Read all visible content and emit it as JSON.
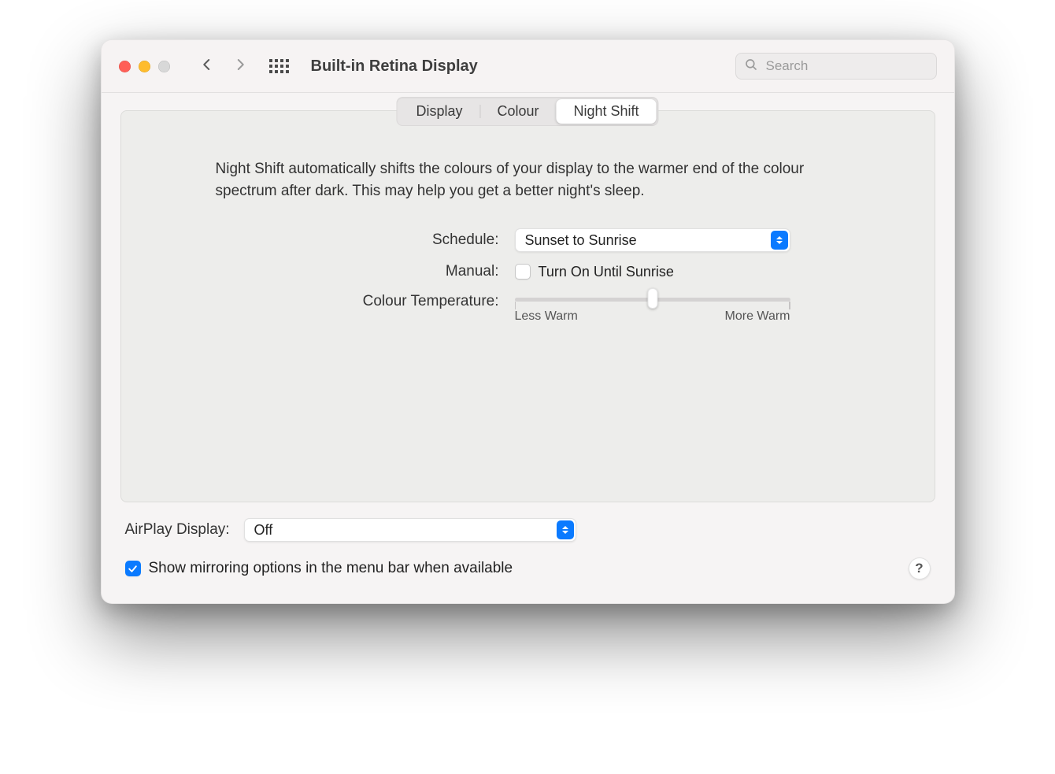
{
  "window": {
    "title": "Built-in Retina Display"
  },
  "search": {
    "placeholder": "Search"
  },
  "tabs": [
    {
      "label": "Display",
      "active": false
    },
    {
      "label": "Colour",
      "active": false
    },
    {
      "label": "Night Shift",
      "active": true
    }
  ],
  "pane": {
    "description": "Night Shift automatically shifts the colours of your display to the warmer end of the colour spectrum after dark. This may help you get a better night's sleep.",
    "schedule_label": "Schedule:",
    "schedule_value": "Sunset to Sunrise",
    "manual_label": "Manual:",
    "manual_checkbox_label": "Turn On Until Sunrise",
    "manual_checked": false,
    "temp_label": "Colour Temperature:",
    "temp_min_label": "Less Warm",
    "temp_max_label": "More Warm",
    "temp_value_percent": 50
  },
  "footer": {
    "airplay_label": "AirPlay Display:",
    "airplay_value": "Off",
    "mirror_checked": true,
    "mirror_label": "Show mirroring options in the menu bar when available",
    "help_label": "?"
  }
}
